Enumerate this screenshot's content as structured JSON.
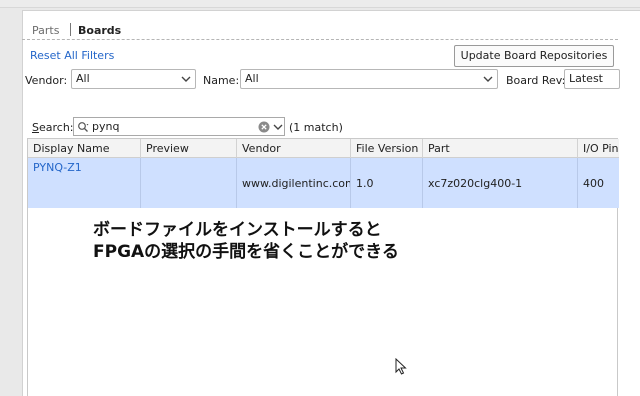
{
  "tabs": {
    "parts": "Parts",
    "boards": "Boards"
  },
  "filters": {
    "reset_label": "Reset All Filters",
    "update_button": "Update Board Repositories",
    "vendor_label": "Vendor:",
    "vendor_value": "All",
    "name_label": "Name:",
    "name_value": "All",
    "boardrev_label": "Board Rev:",
    "boardrev_value": "Latest"
  },
  "search": {
    "label_prefix": "S",
    "label_rest": "earch:",
    "value": "pynq",
    "match": "(1 match)"
  },
  "table": {
    "headers": [
      "Display Name",
      "Preview",
      "Vendor",
      "File Version",
      "Part",
      "I/O Pin"
    ],
    "rows": [
      {
        "display_name": "PYNQ-Z1",
        "preview": "",
        "vendor": "www.digilentinc.com",
        "file_version": "1.0",
        "part": "xc7z020clg400-1",
        "io_pins": "400"
      }
    ]
  },
  "caption": {
    "line1": "ボードファイルをインストールすると",
    "line2": "FPGAの選択の手間を省くことができる"
  }
}
